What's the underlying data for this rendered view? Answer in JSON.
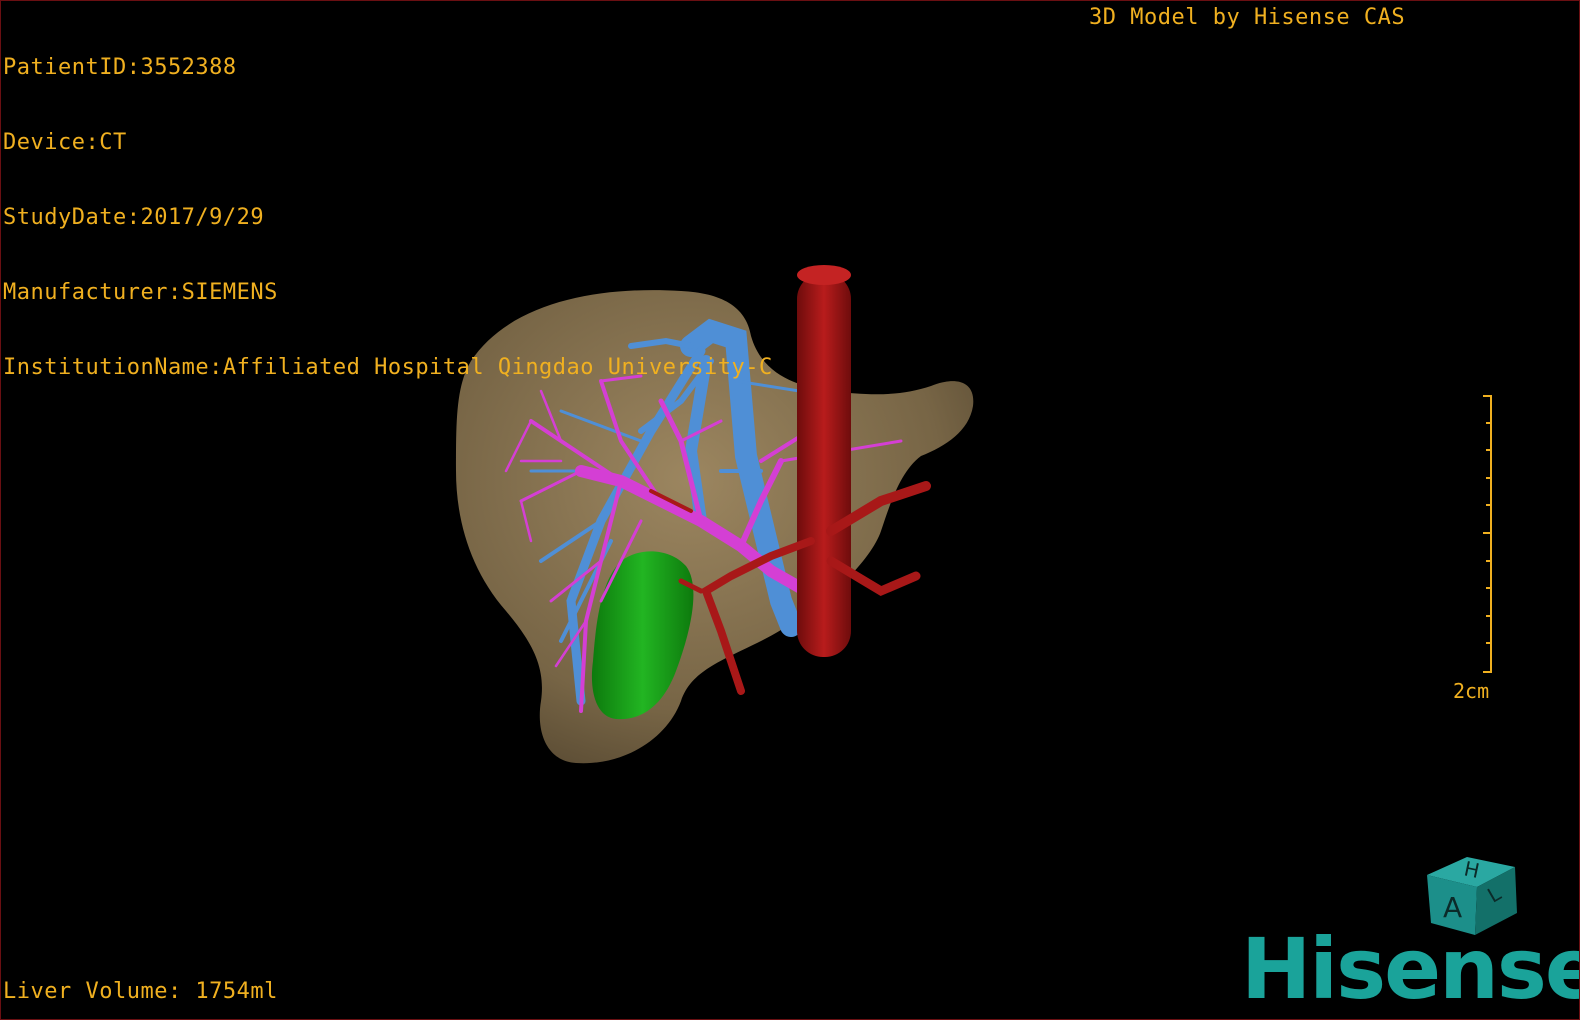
{
  "overlay": {
    "patient_id": "PatientID:3552388",
    "device": "Device:CT",
    "study_date": "StudyDate:2017/9/29",
    "manufacturer": "Manufacturer:SIEMENS",
    "institution": "InstitutionName:Affiliated Hospital Qingdao University-C",
    "credit": "3D Model by Hisense CAS",
    "liver_volume": "Liver Volume: 1754ml",
    "scale_label": "2cm"
  },
  "orientation_cube": {
    "top_letter": "H",
    "front_letter": "A",
    "side_letter": "L"
  },
  "brand": {
    "logo_text": "Hisense"
  },
  "colors": {
    "overlay_text": "#f0b020",
    "liver": "#8a7552",
    "hepatic_vein": "#4f8fd6",
    "portal_vein": "#d43fd4",
    "artery_ivc": "#a81818",
    "gallbladder": "#19a319",
    "brand": "#1aa39a",
    "cube": "#1c8f8a"
  },
  "icons": {
    "orientation_cube": "orientation-cube-icon"
  }
}
